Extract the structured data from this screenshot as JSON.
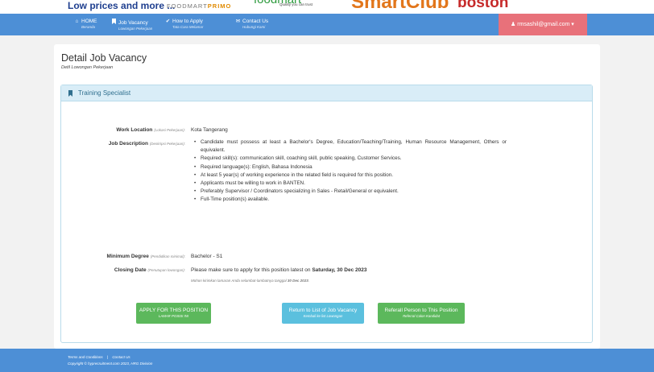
{
  "brands": {
    "tagline": "Low prices and more ...",
    "foodmart_primo": "FOODMART",
    "foodmart_primo_bold": "PRIMO",
    "foodmart": "foodmart",
    "foodmart_tagline": "Quality you can trust",
    "smartclub": "SmartClub",
    "boston": "boston"
  },
  "nav": {
    "items": [
      {
        "label": "HOME",
        "sub": "Beranda",
        "icon": "home-icon"
      },
      {
        "label": "Job Vacancy",
        "sub": "Lowongan Pekerjaan",
        "icon": "bookmark-icon"
      },
      {
        "label": "How to Apply",
        "sub": "Tata Cara Melamar",
        "icon": "check-icon"
      },
      {
        "label": "Contact Us",
        "sub": "Hubungi Kami",
        "icon": "envelope-icon"
      }
    ],
    "user": "rmsashil@gmail.com"
  },
  "page": {
    "title": "Detail Job Vacancy",
    "subtitle": "Detil Lowongan Pekerjaan"
  },
  "job": {
    "title": "Training Specialist",
    "work_location_label": "Work Location",
    "work_location_sub": "(Lokasi Pekerjaan):",
    "work_location": "Kota Tangerang",
    "description_label": "Job Description",
    "description_sub": "(Deskripsi Pekerjaan):",
    "description": [
      "Candidate must possess at least a Bachelor's Degree, Education/Teaching/Training, Human Resource Management, Others or equivalent.",
      "Required skill(s): communication skill, coaching skill, public speaking, Customer Services.",
      "Required language(s): English, Bahasa Indonesia",
      "At least 5 year(s) of working experience in the related field is required for this position.",
      "Applicants must be willing to work in BANTEN.",
      "Preferably Supervisor / Coordinators specializing in Sales - Retail/General or equivalent.",
      "Full-Time position(s) available."
    ],
    "degree_label": "Minimum Degree",
    "degree_sub": "(Pendidikan minimal):",
    "degree": "Bachelor - S1",
    "closing_label": "Closing Date",
    "closing_sub": "(Penutupan lowongan):",
    "closing_text": "Please make sure to apply for this position latest on",
    "closing_date": "Saturday, 30 Dec 2023",
    "closing_note": "Mohon kirimkan lamaran Anda selambat-lambatnya tanggal",
    "closing_note_date": "30 Dec 2023",
    "closing_note_end": "."
  },
  "buttons": {
    "apply": {
      "label": "APPLY FOR THIS POSITION",
      "sub": "LAMAR POSISI INI"
    },
    "return": {
      "label": "Return to List of Job Vacancy",
      "sub": "Kembali ke list Lowongan"
    },
    "referral": {
      "label": "Referall Person to This Position",
      "sub": "Referral Calon Kandidat"
    }
  },
  "footer": {
    "terms": "Terms and Conditions",
    "separator": "|",
    "contact": "Contact Us",
    "copyright": "Copyright © hyprecruitment.com 2023, HRG Division"
  },
  "colors": {
    "navbar": "#4d8fd6",
    "user_menu": "#e8717a",
    "panel_heading": "#d9edf7",
    "btn_green": "#5cb85c",
    "btn_blue": "#5bc0de"
  }
}
